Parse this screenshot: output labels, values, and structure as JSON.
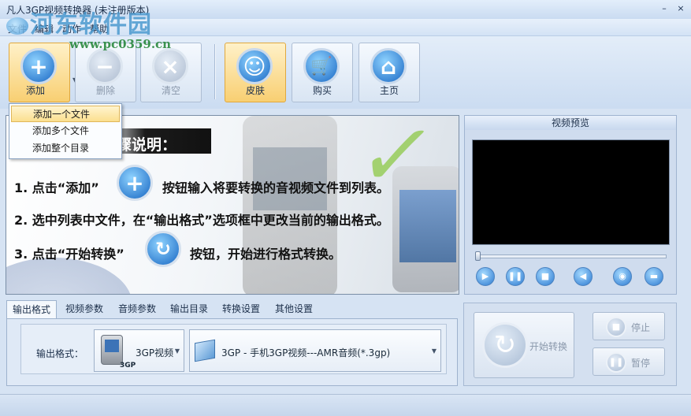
{
  "window": {
    "title": "凡人3GP视频转换器 (未注册版本)",
    "minimize_glyph": "–",
    "close_glyph": "×"
  },
  "watermark": {
    "text": "河东软件园",
    "url": "www.pc0359.cn"
  },
  "menu": [
    "文件",
    "编辑",
    "动作",
    "帮助"
  ],
  "toolbar": {
    "add": "添加",
    "delete": "删除",
    "clear": "清空",
    "skin": "皮肤",
    "buy": "购买",
    "home": "主页"
  },
  "add_menu": [
    "添加一个文件",
    "添加多个文件",
    "添加整个目录"
  ],
  "guide": {
    "title": "骤说明：",
    "step1_a": "1. 点击“添加”",
    "step1_b": "按钮输入将要转换的音视频文件到列表。",
    "step2": "2. 选中列表中文件，在“输出格式”选项框中更改当前的输出格式。",
    "step3_a": "3. 点击“开始转换”",
    "step3_b": "按钮，开始进行格式转换。"
  },
  "preview": {
    "title": "视频预览",
    "controls": [
      "play-icon",
      "pause-icon",
      "stop-icon",
      "volume-icon",
      "snapshot-icon",
      "folder-icon"
    ],
    "seek_position": 0
  },
  "tabs": [
    "输出格式",
    "视频参数",
    "音频参数",
    "输出目录",
    "转换设置",
    "其他设置"
  ],
  "output": {
    "label": "输出格式：",
    "device": "3GP视频",
    "device_badge": "3GP",
    "profile": "3GP - 手机3GP视频---AMR音频(*.3gp)"
  },
  "actions": {
    "start": "开始转换",
    "stop": "停止",
    "pause": "暂停"
  },
  "colors": {
    "accent_blue": "#1a68c4",
    "skin_active": "#f8cf72",
    "watermark": "#4696cd"
  }
}
